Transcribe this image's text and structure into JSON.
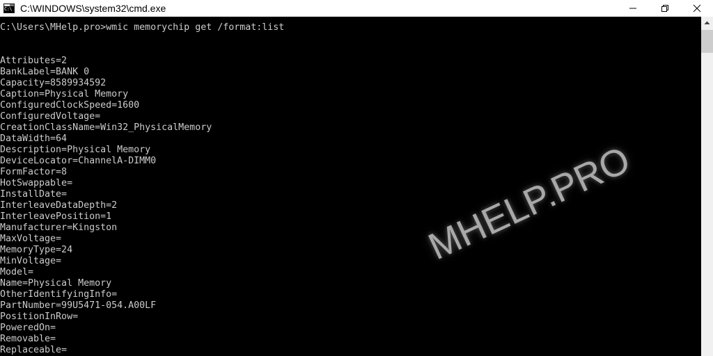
{
  "window": {
    "title": "C:\\WINDOWS\\system32\\cmd.exe",
    "icon": "cmd-console-icon",
    "icon_text": "C:\\",
    "background_color": "#000000",
    "titlebar_color": "#ffffff",
    "text_color": "#cccccc",
    "controls": {
      "minimize": "minimize-button",
      "maximize": "restore-button",
      "close": "close-button"
    }
  },
  "console": {
    "prompt_line": "C:\\Users\\MHelp.pro>wmic memorychip get /format:list",
    "blank_after_prompt": "",
    "lines": [
      "C:\\Users\\MHelp.pro>wmic memorychip get /format:list",
      "",
      "",
      "Attributes=2",
      "BankLabel=BANK 0",
      "Capacity=8589934592",
      "Caption=Physical Memory",
      "ConfiguredClockSpeed=1600",
      "ConfiguredVoltage=",
      "CreationClassName=Win32_PhysicalMemory",
      "DataWidth=64",
      "Description=Physical Memory",
      "DeviceLocator=ChannelA-DIMM0",
      "FormFactor=8",
      "HotSwappable=",
      "InstallDate=",
      "InterleaveDataDepth=2",
      "InterleavePosition=1",
      "Manufacturer=Kingston",
      "MaxVoltage=",
      "MemoryType=24",
      "MinVoltage=",
      "Model=",
      "Name=Physical Memory",
      "OtherIdentifyingInfo=",
      "PartNumber=99U5471-054.A00LF",
      "PositionInRow=",
      "PoweredOn=",
      "Removable=",
      "Replaceable="
    ],
    "properties": [
      {
        "key": "Attributes",
        "value": "2"
      },
      {
        "key": "BankLabel",
        "value": "BANK 0"
      },
      {
        "key": "Capacity",
        "value": "8589934592"
      },
      {
        "key": "Caption",
        "value": "Physical Memory"
      },
      {
        "key": "ConfiguredClockSpeed",
        "value": "1600"
      },
      {
        "key": "ConfiguredVoltage",
        "value": ""
      },
      {
        "key": "CreationClassName",
        "value": "Win32_PhysicalMemory"
      },
      {
        "key": "DataWidth",
        "value": "64"
      },
      {
        "key": "Description",
        "value": "Physical Memory"
      },
      {
        "key": "DeviceLocator",
        "value": "ChannelA-DIMM0"
      },
      {
        "key": "FormFactor",
        "value": "8"
      },
      {
        "key": "HotSwappable",
        "value": ""
      },
      {
        "key": "InstallDate",
        "value": ""
      },
      {
        "key": "InterleaveDataDepth",
        "value": "2"
      },
      {
        "key": "InterleavePosition",
        "value": "1"
      },
      {
        "key": "Manufacturer",
        "value": "Kingston"
      },
      {
        "key": "MaxVoltage",
        "value": ""
      },
      {
        "key": "MemoryType",
        "value": "24"
      },
      {
        "key": "MinVoltage",
        "value": ""
      },
      {
        "key": "Model",
        "value": ""
      },
      {
        "key": "Name",
        "value": "Physical Memory"
      },
      {
        "key": "OtherIdentifyingInfo",
        "value": ""
      },
      {
        "key": "PartNumber",
        "value": "99U5471-054.A00LF"
      },
      {
        "key": "PositionInRow",
        "value": ""
      },
      {
        "key": "PoweredOn",
        "value": ""
      },
      {
        "key": "Removable",
        "value": ""
      },
      {
        "key": "Replaceable",
        "value": ""
      }
    ]
  },
  "watermark": {
    "text": "MHELP.PRO",
    "color": "#a8a8a8"
  },
  "scrollbar": {
    "up_arrow": "scroll-up-arrow",
    "thumb": "scroll-thumb"
  }
}
